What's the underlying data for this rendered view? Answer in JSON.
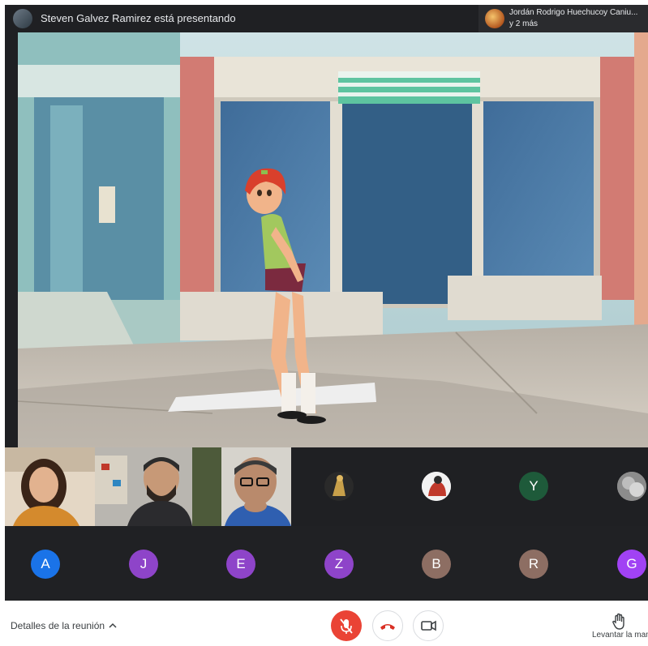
{
  "top_bar": {
    "presenting_text": "Steven Galvez Ramirez está presentando",
    "speaker_name": "Jordán Rodrigo Huechucoy Caniu...",
    "speaker_more": "y 2 más"
  },
  "participants_row1": [
    {
      "kind": "icon-avatar",
      "icon": "golden-figure-icon"
    },
    {
      "kind": "icon-avatar",
      "icon": "red-figure-icon"
    },
    {
      "kind": "letter",
      "letter": "Y",
      "color": "#1e5a3a"
    },
    {
      "kind": "icon-avatar",
      "icon": "gray-photo-icon"
    }
  ],
  "participants_row2": [
    {
      "letter": "A",
      "color": "#1a73e8"
    },
    {
      "letter": "J",
      "color": "#8e44c9"
    },
    {
      "letter": "E",
      "color": "#8e44c9"
    },
    {
      "letter": "Z",
      "color": "#8e44c9"
    },
    {
      "letter": "B",
      "color": "#8d6e63"
    },
    {
      "letter": "R",
      "color": "#8d6e63"
    },
    {
      "letter": "G",
      "color": "#a142f4"
    }
  ],
  "controls": {
    "details_label": "Detalles de la reunión",
    "raise_hand_label": "Levantar la mano",
    "mic_state": "muted",
    "colors": {
      "mic_off_bg": "#ea4335",
      "hangup_icon": "#d93025"
    }
  }
}
